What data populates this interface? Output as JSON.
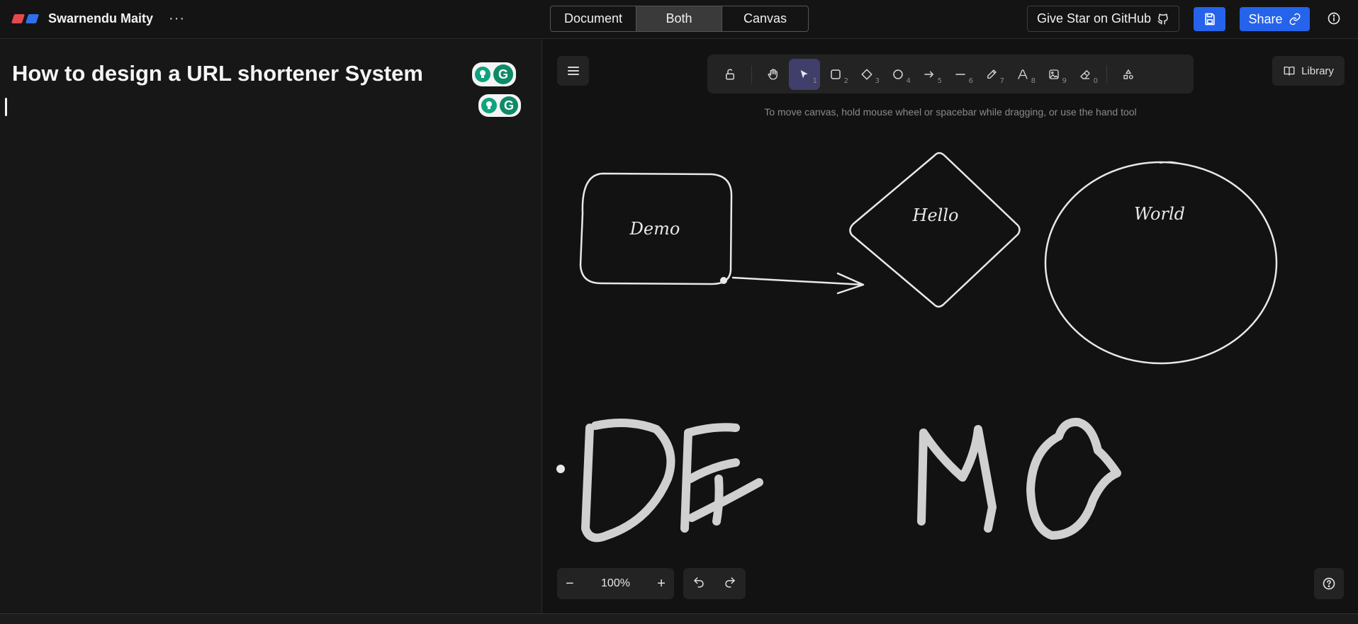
{
  "app": {
    "workspace_name": "Swarnendu Maity",
    "more_glyph": "···"
  },
  "view_toggle": {
    "options": [
      "Document",
      "Both",
      "Canvas"
    ],
    "active": "Both"
  },
  "header_actions": {
    "github_label": "Give Star on GitHub",
    "share_label": "Share"
  },
  "document": {
    "title": "How to design a URL shortener System"
  },
  "canvas": {
    "toolbar": {
      "tools": [
        {
          "name": "lock",
          "num": ""
        },
        {
          "name": "hand",
          "num": ""
        },
        {
          "name": "selection",
          "num": "1",
          "active": true
        },
        {
          "name": "rectangle",
          "num": "2"
        },
        {
          "name": "diamond",
          "num": "3"
        },
        {
          "name": "ellipse",
          "num": "4"
        },
        {
          "name": "arrow",
          "num": "5"
        },
        {
          "name": "line",
          "num": "6"
        },
        {
          "name": "draw",
          "num": "7"
        },
        {
          "name": "text",
          "num": "8"
        },
        {
          "name": "image",
          "num": "9"
        },
        {
          "name": "eraser",
          "num": "0"
        },
        {
          "name": "more-shapes",
          "num": ""
        }
      ]
    },
    "hint": "To move canvas, hold mouse wheel or spacebar while dragging, or use the hand tool",
    "library_label": "Library",
    "shapes": {
      "rect_label": "Demo",
      "diamond_label": "Hello",
      "ellipse_label": "World",
      "freehand_text": "DEMO"
    },
    "zoom": {
      "level": "100%",
      "minus": "−",
      "plus": "+"
    }
  },
  "colors": {
    "accent": "#2563eb",
    "active_tool": "#403e6a",
    "stroke": "#e8e8e8"
  }
}
